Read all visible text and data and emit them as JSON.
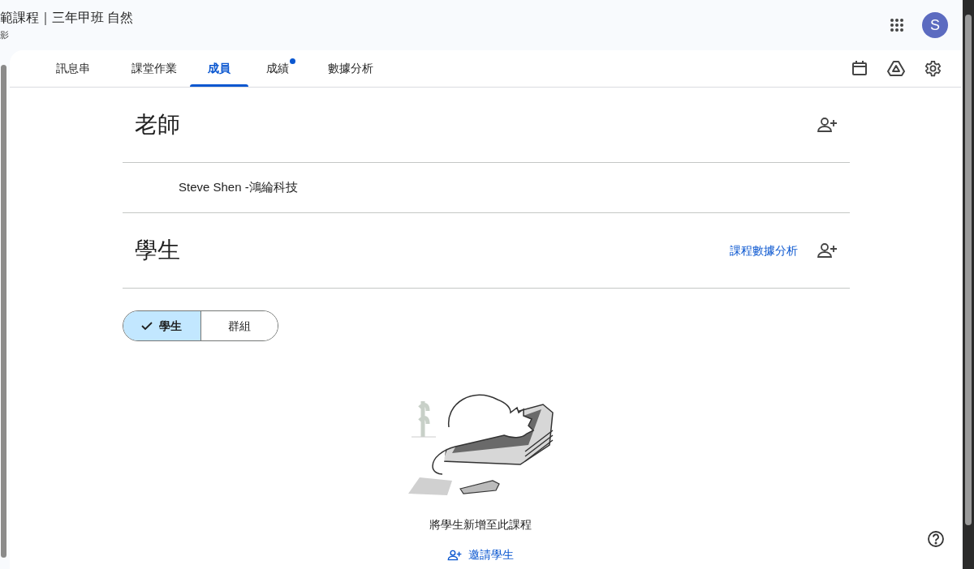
{
  "header": {
    "title": "範課程｜三年甲班 自然",
    "subtitle": "影",
    "avatar": "S"
  },
  "tabs": [
    {
      "label": "訊息串",
      "selected": false,
      "badge": false
    },
    {
      "label": "課堂作業",
      "selected": false,
      "badge": false
    },
    {
      "label": "成員",
      "selected": true,
      "badge": false
    },
    {
      "label": "成績",
      "selected": false,
      "badge": true
    },
    {
      "label": "數據分析",
      "selected": false,
      "badge": false
    }
  ],
  "teachers": {
    "heading": "老師",
    "members": [
      "Steve Shen -鴻綸科技"
    ]
  },
  "students": {
    "heading": "學生",
    "link": "課程數據分析",
    "filters": [
      {
        "label": "學生",
        "selected": true
      },
      {
        "label": "群組",
        "selected": false
      }
    ],
    "empty_message": "將學生新增至此課程",
    "invite": "邀請學生"
  }
}
